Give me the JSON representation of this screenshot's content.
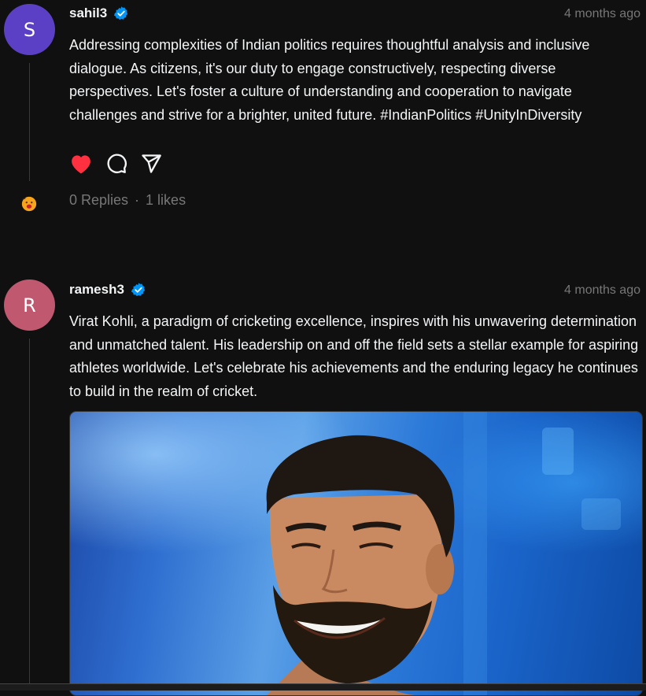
{
  "posts": [
    {
      "avatar_letter": "S",
      "avatar_color": "#5b3fc4",
      "username": "sahil3",
      "verified": true,
      "timestamp": "4 months ago",
      "text": "Addressing complexities of Indian politics requires thoughtful analysis and inclusive dialogue. As citizens, it's our duty to engage constructively, respecting diverse perspectives. Let's foster a culture of understanding and cooperation to navigate challenges and strive for a brighter, united future. #IndianPolitics #UnityInDiversity",
      "liked": true,
      "replies": "0 Replies",
      "separator": "·",
      "likes": "1 likes",
      "replier_icon": "emoji-face-icon"
    },
    {
      "avatar_letter": "R",
      "avatar_color": "#c0596f",
      "username": "ramesh3",
      "verified": true,
      "timestamp": "4 months ago",
      "text": "Virat Kohli, a paradigm of cricketing excellence, inspires with his unwavering determination and unmatched talent. His leadership on and off the field sets a stellar example for aspiring athletes worldwide. Let's celebrate his achievements and the enduring legacy he continues to build in the realm of cricket.",
      "image": "portrait-photo"
    }
  ],
  "colors": {
    "background": "#101010",
    "text": "#f3f5f7",
    "muted": "#777777",
    "like": "#ff3040",
    "verified": "#0095f6"
  }
}
